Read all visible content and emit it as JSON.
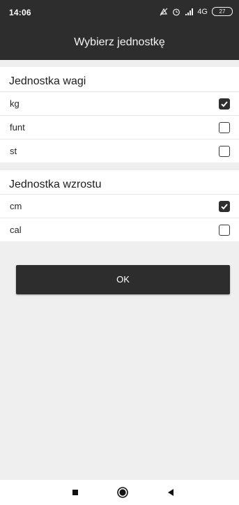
{
  "status_bar": {
    "time": "14:06",
    "network": "4G",
    "battery": "27",
    "icons": [
      "mute-icon",
      "alarm-icon",
      "signal-icon",
      "network-type-icon",
      "battery-icon"
    ]
  },
  "header": {
    "title": "Wybierz jednostkę"
  },
  "weight_section": {
    "title": "Jednostka wagi",
    "options": [
      {
        "label": "kg",
        "checked": true
      },
      {
        "label": "funt",
        "checked": false
      },
      {
        "label": "st",
        "checked": false
      }
    ]
  },
  "height_section": {
    "title": "Jednostka wzrostu",
    "options": [
      {
        "label": "cm",
        "checked": true
      },
      {
        "label": "cal",
        "checked": false
      }
    ]
  },
  "ok_button": {
    "label": "OK"
  },
  "nav_bar": {
    "icons": [
      "recents-square-icon",
      "home-circle-icon",
      "back-triangle-icon"
    ]
  },
  "colors": {
    "bar_background": "#2d2d2d",
    "page_background": "#efefef",
    "panel_background": "#ffffff"
  }
}
